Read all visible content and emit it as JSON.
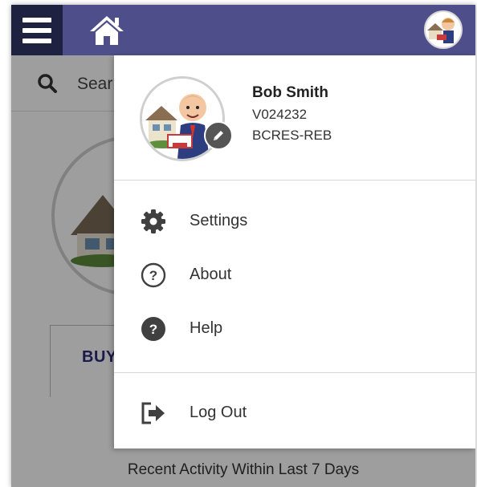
{
  "colors": {
    "appbar": "#4e4e8b",
    "menu_button_bg": "#1f2140",
    "accent_text": "#2a2a7a"
  },
  "appbar": {
    "menu_icon": "hamburger-menu-icon",
    "home_icon": "home-icon",
    "avatar": "user-avatar"
  },
  "background": {
    "search_placeholder": "Sear",
    "buy_label": "BUY",
    "recent_activity": "Recent Activity Within Last 7 Days"
  },
  "drawer": {
    "profile": {
      "name": "Bob Smith",
      "id": "V024232",
      "org": "BCRES-REB",
      "edit_icon": "pencil-icon"
    },
    "menu": [
      {
        "label": "Settings",
        "icon": "gear-icon"
      },
      {
        "label": "About",
        "icon": "question-circle-outline-icon"
      },
      {
        "label": "Help",
        "icon": "question-circle-filled-icon"
      }
    ],
    "logout": {
      "label": "Log Out",
      "icon": "logout-icon"
    }
  }
}
